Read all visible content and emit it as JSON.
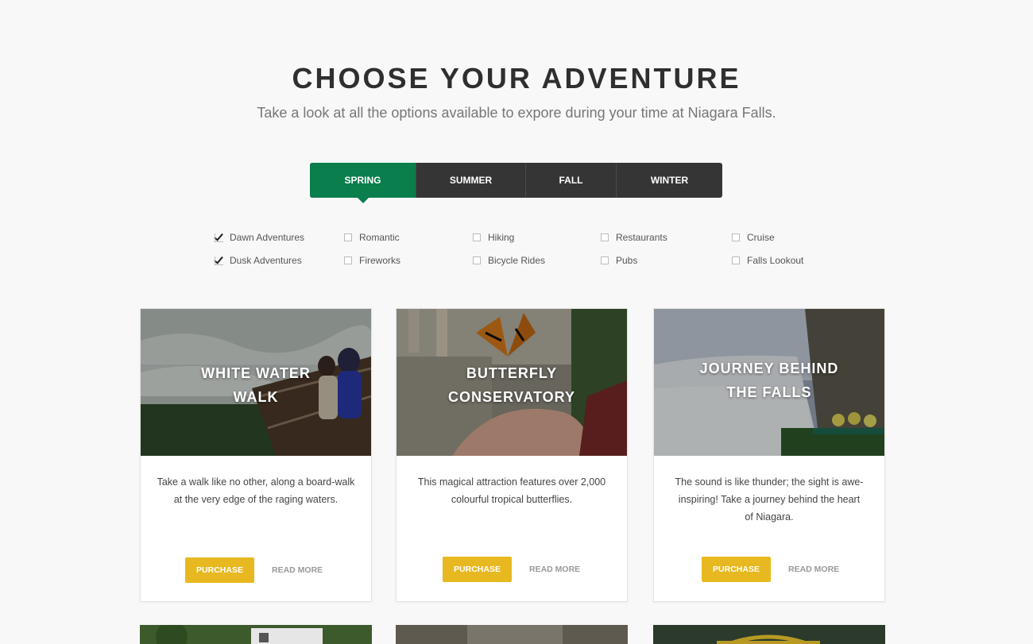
{
  "header": {
    "title": "CHOOSE YOUR ADVENTURE",
    "subtitle": "Take a look at all the options available to expore during your time at Niagara Falls."
  },
  "tabs": [
    {
      "label": "SPRING",
      "active": true
    },
    {
      "label": "SUMMER",
      "active": false
    },
    {
      "label": "FALL",
      "active": false
    },
    {
      "label": "WINTER",
      "active": false
    }
  ],
  "filters": [
    {
      "label": "Dawn Adventures",
      "checked": true
    },
    {
      "label": "Dusk Adventures",
      "checked": true
    },
    {
      "label": "Romantic",
      "checked": false
    },
    {
      "label": "Fireworks",
      "checked": false
    },
    {
      "label": "Hiking",
      "checked": false
    },
    {
      "label": "Bicycle Rides",
      "checked": false
    },
    {
      "label": "Restaurants",
      "checked": false
    },
    {
      "label": "Pubs",
      "checked": false
    },
    {
      "label": "Cruise",
      "checked": false
    },
    {
      "label": "Falls Lookout",
      "checked": false
    }
  ],
  "cards": [
    {
      "title_line1": "WHITE WATER",
      "title_line2": "WALK",
      "description": "Take a walk like no other, along a board-walk at the very edge of the raging waters.",
      "purchase_label": "PURCHASE",
      "readmore_label": "READ MORE"
    },
    {
      "title_line1": "BUTTERFLY",
      "title_line2": "CONSERVATORY",
      "description": "This magical attraction features over 2,000 colourful tropical butterflies.",
      "purchase_label": "PURCHASE",
      "readmore_label": "READ MORE"
    },
    {
      "title_line1": "JOURNEY BEHIND",
      "title_line2": "THE FALLS",
      "description": "The sound is like thunder; the sight is awe-inspiring! Take a journey behind the heart of Niagara.",
      "purchase_label": "PURCHASE",
      "readmore_label": "READ MORE"
    }
  ],
  "colors": {
    "active_tab": "#0a7e4c",
    "tab_bar": "#353535",
    "purchase_button": "#e8b820"
  }
}
